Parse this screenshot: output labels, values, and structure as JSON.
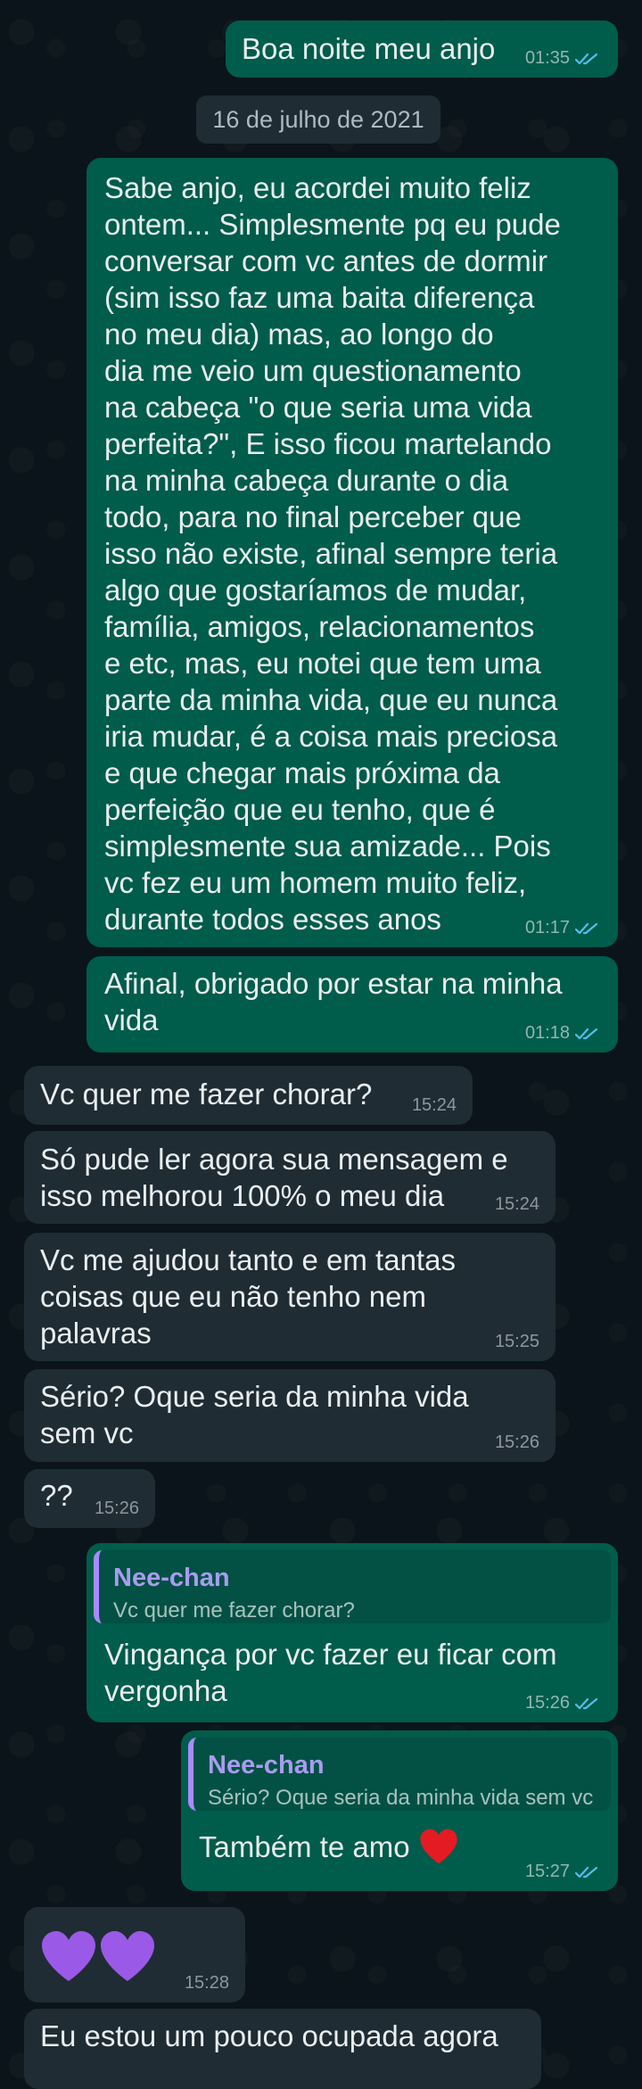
{
  "messages": [
    {
      "text": "Boa noite meu anjo",
      "time": "01:35"
    },
    {
      "date": "16 de julho de 2021"
    },
    {
      "text": "Sabe anjo, eu acordei muito feliz\nontem... Simplesmente pq eu pude\nconversar com vc antes de dormir\n(sim isso faz uma baita diferença\nno meu dia) mas, ao longo do\ndia me veio um questionamento\nna cabeça \"o que seria uma vida\nperfeita?\", E isso ficou martelando\nna minha cabeça durante o dia\ntodo, para no final perceber que\nisso não existe, afinal sempre teria\nalgo que gostaríamos de mudar,\nfamília, amigos, relacionamentos\ne etc, mas, eu notei que tem uma\nparte da minha vida, que eu nunca\niria mudar, é a coisa mais preciosa\ne que chegar mais próxima da\nperfeição que eu tenho, que é\nsimplesmente sua amizade... Pois\nvc fez eu um homem muito feliz,\ndurante todos esses anos",
      "time": "01:17"
    },
    {
      "text": "Afinal, obrigado por estar na minha\nvida",
      "time": "01:18"
    },
    {
      "text": "Vc quer me fazer chorar?",
      "time": "15:24"
    },
    {
      "text": "Só pude ler agora sua mensagem e\nisso melhorou 100% o meu dia",
      "time": "15:24"
    },
    {
      "text": "Vc me ajudou tanto e em tantas\ncoisas que eu não tenho nem\npalavras",
      "time": "15:25"
    },
    {
      "text": "Sério? Oque seria da minha vida\nsem vc",
      "time": "15:26"
    },
    {
      "text": "??",
      "time": "15:26"
    },
    {
      "quote_name": "Nee-chan",
      "quote_text": "Vc quer me fazer chorar?",
      "text": "Vingança por vc fazer eu ficar com\nvergonha",
      "time": "15:26"
    },
    {
      "quote_name": "Nee-chan",
      "quote_text": "Sério? Oque seria da minha vida sem vc",
      "text": "Também te amo",
      "emoji": "red-heart",
      "time": "15:27"
    },
    {
      "emoji": "purple-heart x2",
      "time": "15:28"
    },
    {
      "text": "Eu estou um pouco ocupada agora"
    }
  ],
  "colors": {
    "outgoing": "#005c4b",
    "incoming": "#1f2c34",
    "read_tick": "#53bdeb",
    "background": "#0b141a",
    "quote_name": "#a99cf0"
  }
}
